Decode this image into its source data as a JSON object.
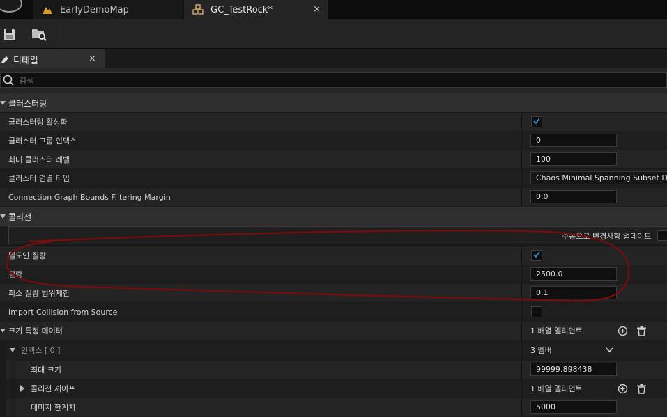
{
  "window": {
    "tabs": [
      {
        "label": "EarlyDemoMap",
        "icon": "level-icon"
      },
      {
        "label": "GC_TestRock*",
        "icon": "geometry-collection-icon"
      }
    ],
    "close_glyph": "×"
  },
  "toolbar": {
    "buttons": [
      {
        "name": "save-icon"
      },
      {
        "name": "browse-asset-icon"
      }
    ]
  },
  "details_panel": {
    "tab_label": "디테일",
    "search_placeholder": "검색"
  },
  "sections": {
    "clustering": {
      "title": "클러스터링",
      "props": {
        "enable": {
          "label": "클러스터링 활성화",
          "checked": true
        },
        "group_index": {
          "label": "클러스터 그룹 인덱스",
          "value": "0"
        },
        "max_level": {
          "label": "최대 클러스터 레벨",
          "value": "100"
        },
        "connection_type": {
          "label": "클러스터 연결 타입",
          "value": "Chaos Minimal Spanning Subset Dela"
        },
        "bounds_margin": {
          "label": "Connection Graph Bounds Filtering Margin",
          "value": "0.0"
        }
      }
    },
    "collision": {
      "title": "콜리전",
      "update_button": "수동으로 변경사항 업데이트",
      "props": {
        "mass_as_density": {
          "label": "밀도인 질량",
          "checked": true
        },
        "mass": {
          "label": "질량",
          "value": "2500.0"
        },
        "min_mass_clamp": {
          "label": "최소 질량 범위제한",
          "value": "0.1"
        },
        "import_collision": {
          "label": "Import Collision from Source",
          "checked": false
        },
        "size_specific": {
          "label": "크기 특정 데이터",
          "value": "1 배열 엘리먼트"
        },
        "index0": {
          "label": "인덱스 [ 0 ]",
          "value": "3 멤버"
        },
        "max_size": {
          "label": "최대 크기",
          "value": "99999.898438"
        },
        "collision_shapes": {
          "label": "콜리전 셰이프",
          "value": "1 배열 엘리먼트"
        },
        "damage_threshold": {
          "label": "대미지 한계치",
          "value": "5000"
        }
      }
    }
  },
  "colors": {
    "accent_check": "#3b8fe0",
    "annotation": "#7a0c0c"
  }
}
